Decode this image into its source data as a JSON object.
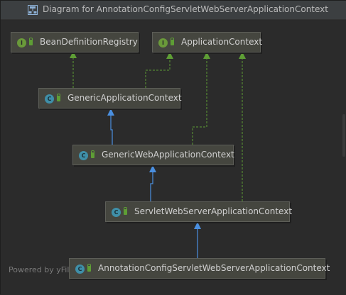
{
  "window": {
    "title": "Diagram for AnnotationConfigServletWebServerApplicationContext"
  },
  "nodes": {
    "bean_definition_registry": {
      "label": "BeanDefinitionRegistry",
      "kind": "interface",
      "badge": "I"
    },
    "application_context": {
      "label": "ApplicationContext",
      "kind": "interface",
      "badge": "I"
    },
    "generic_application_context": {
      "label": "GenericApplicationContext",
      "kind": "class",
      "badge": "C"
    },
    "generic_web_application_context": {
      "label": "GenericWebApplicationContext",
      "kind": "class",
      "badge": "C"
    },
    "servlet_web_server_application_context": {
      "label": "ServletWebServerApplicationContext",
      "kind": "class",
      "badge": "C"
    },
    "annotation_config_servlet_web_server_application_context": {
      "label": "AnnotationConfigServletWebServerApplicationContext",
      "kind": "class",
      "badge": "C"
    }
  },
  "edges": [
    {
      "from": "generic_application_context",
      "to": "bean_definition_registry",
      "type": "implements"
    },
    {
      "from": "generic_application_context",
      "to": "application_context",
      "type": "implements"
    },
    {
      "from": "generic_web_application_context",
      "to": "application_context",
      "type": "implements"
    },
    {
      "from": "servlet_web_server_application_context",
      "to": "application_context",
      "type": "implements"
    },
    {
      "from": "generic_web_application_context",
      "to": "generic_application_context",
      "type": "extends"
    },
    {
      "from": "servlet_web_server_application_context",
      "to": "generic_web_application_context",
      "type": "extends"
    },
    {
      "from": "annotation_config_servlet_web_server_application_context",
      "to": "servlet_web_server_application_context",
      "type": "extends"
    }
  ],
  "footer": {
    "powered_by": "Powered by yFil"
  },
  "colors": {
    "background": "#2b2b2b",
    "node_fill": "#45463f",
    "implements_edge": "#5e9e35",
    "extends_edge": "#4a8fe0",
    "interface_badge": "#6a9a3a",
    "class_badge": "#3f8fa8"
  }
}
